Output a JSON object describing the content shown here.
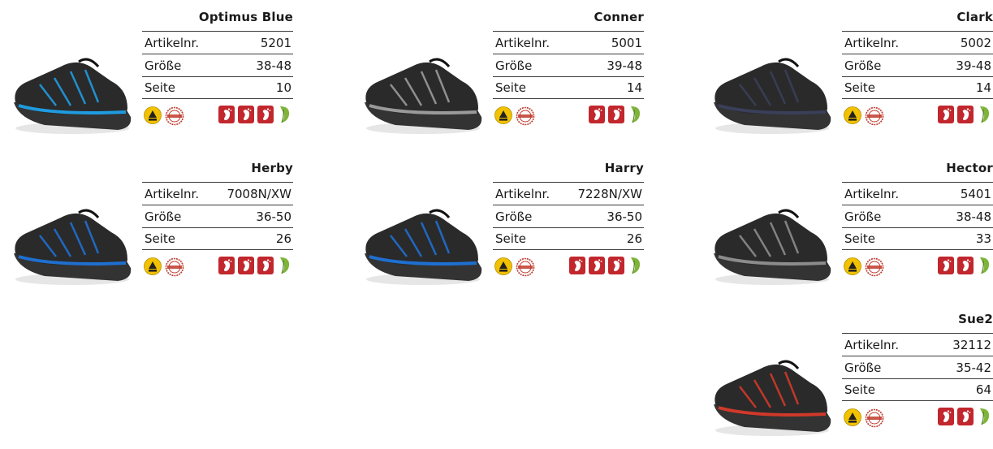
{
  "labels": {
    "artikel": "Artikelnr.",
    "groesse": "Größe",
    "seite": "Seite"
  },
  "colors": {
    "foot_red": "#c1272d",
    "leaf_green": "#7fb33a",
    "esd_yellow": "#f2c200",
    "stamp_red": "#c0392b"
  },
  "products": [
    {
      "name": "Optimus Blue",
      "artikel": "5201",
      "groesse": "38-48",
      "seite": "10",
      "feet": 3,
      "leaf": true,
      "accent": "#1f9be0"
    },
    {
      "name": "Conner",
      "artikel": "5001",
      "groesse": "39-48",
      "seite": "14",
      "feet": 2,
      "leaf": true,
      "accent": "#9a9a9a"
    },
    {
      "name": "Clark",
      "artikel": "5002",
      "groesse": "39-48",
      "seite": "14",
      "feet": 2,
      "leaf": true,
      "accent": "#3a3f5a"
    },
    {
      "name": "Herby",
      "artikel": "7008N/XW",
      "groesse": "36-50",
      "seite": "26",
      "feet": 3,
      "leaf": true,
      "accent": "#1f6fd0"
    },
    {
      "name": "Harry",
      "artikel": "7228N/XW",
      "groesse": "36-50",
      "seite": "26",
      "feet": 3,
      "leaf": true,
      "accent": "#1f6fd0"
    },
    {
      "name": "Hector",
      "artikel": "5401",
      "groesse": "38-48",
      "seite": "33",
      "feet": 2,
      "leaf": true,
      "accent": "#8c8c8c"
    },
    {
      "name": "Sue2",
      "artikel": "32112",
      "groesse": "35-42",
      "seite": "64",
      "feet": 2,
      "leaf": true,
      "accent": "#d0392a"
    }
  ]
}
